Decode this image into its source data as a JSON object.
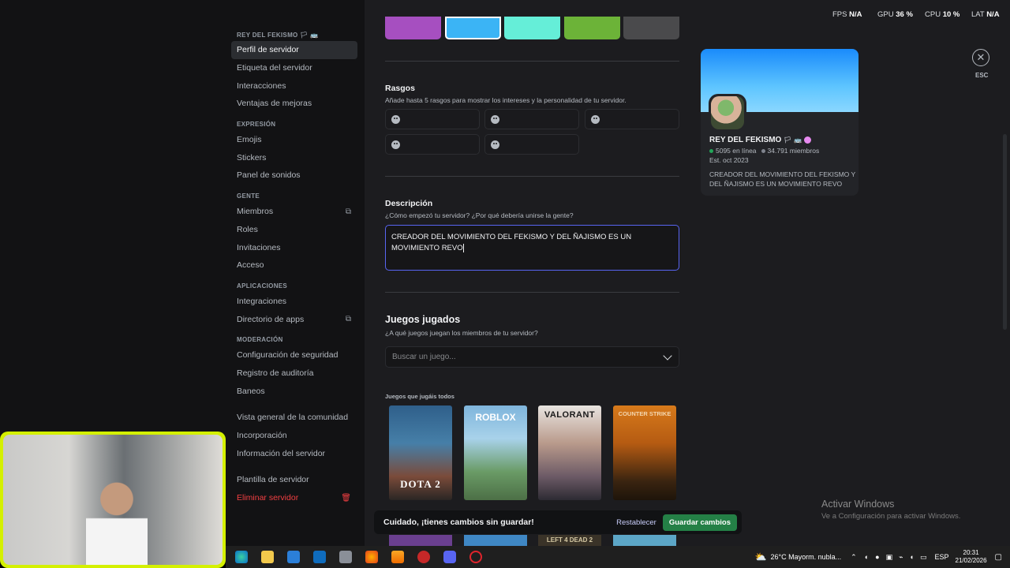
{
  "sidebar": {
    "server_header": "REY DEL FEKISMO 🏳 🚌",
    "items": [
      {
        "label": "Perfil de servidor"
      },
      {
        "label": "Etiqueta del servidor"
      },
      {
        "label": "Interacciones"
      },
      {
        "label": "Ventajas de mejoras"
      }
    ],
    "expresion_header": "EXPRESIÓN",
    "expresion_items": [
      {
        "label": "Emojis"
      },
      {
        "label": "Stickers"
      },
      {
        "label": "Panel de sonidos"
      }
    ],
    "gente_header": "GENTE",
    "gente_items": [
      {
        "label": "Miembros"
      },
      {
        "label": "Roles"
      },
      {
        "label": "Invitaciones"
      },
      {
        "label": "Acceso"
      }
    ],
    "apps_header": "APLICACIONES",
    "apps_items": [
      {
        "label": "Integraciones"
      },
      {
        "label": "Directorio de apps"
      }
    ],
    "mod_header": "MODERACIÓN",
    "mod_items": [
      {
        "label": "Configuración de seguridad"
      },
      {
        "label": "Registro de auditoría"
      },
      {
        "label": "Baneos"
      }
    ],
    "community_items": [
      {
        "label": "Vista general de la comunidad"
      },
      {
        "label": "Incorporación"
      },
      {
        "label": "Información del servidor"
      }
    ],
    "template_label": "Plantilla de servidor",
    "delete_label": "Eliminar servidor"
  },
  "swatches": [
    "#a64fc0",
    "#3bb4f5",
    "#65eed8",
    "#6cb338",
    "#4a4a4c"
  ],
  "traits": {
    "title": "Rasgos",
    "subtitle": "Añade hasta 5 rasgos para mostrar los intereses y la personalidad de tu servidor."
  },
  "description": {
    "title": "Descripción",
    "subtitle": "¿Cómo empezó tu servidor? ¿Por qué debería unirse la gente?",
    "value": "CREADOR DEL MOVIMIENTO DEL FEKISMO Y DEL ÑAJISMO ES UN MOVIMIENTO REVO"
  },
  "games": {
    "title": "Juegos jugados",
    "subtitle": "¿A qué juegos juegan los miembros de tu servidor?",
    "placeholder": "Buscar un juego...",
    "played_label": "Juegos que jugáis todos",
    "cards": [
      {
        "name": "DOTA 2",
        "logo": "DOTA 2"
      },
      {
        "name": "Roblox",
        "logo": "ROBLOX"
      },
      {
        "name": "Valorant",
        "logo": "VALORANT"
      },
      {
        "name": "Counter-Strike 2",
        "logo": "COUNTER STRIKE"
      }
    ],
    "second_row_logo": "LEFT 4 DEAD 2"
  },
  "preview": {
    "name": "REY DEL FEKISMO",
    "online": "5095 en línea",
    "members": "34.791 miembros",
    "established": "Est. oct 2023",
    "description": "CREADOR DEL MOVIMIENTO DEL FEKISMO Y DEL ÑAJISMO ES UN MOVIMIENTO REVO"
  },
  "esc": {
    "label": "ESC"
  },
  "perf": {
    "fps_label": "FPS",
    "fps_value": "N/A",
    "gpu_label": "GPU",
    "gpu_value": "36 %",
    "cpu_label": "CPU",
    "cpu_value": "10 %",
    "lat_label": "LAT",
    "lat_value": "N/A"
  },
  "unsaved": {
    "message": "Cuidado, ¡tienes cambios sin guardar!",
    "reset": "Restablecer",
    "save": "Guardar cambios"
  },
  "windows_watermark": {
    "line1": "Activar Windows",
    "line2": "Ve a Configuración para activar Windows."
  },
  "taskbar": {
    "weather": "26°C  Mayorm. nubla...",
    "lang": "ESP",
    "time": "20:31",
    "date": "21/02/2026"
  }
}
